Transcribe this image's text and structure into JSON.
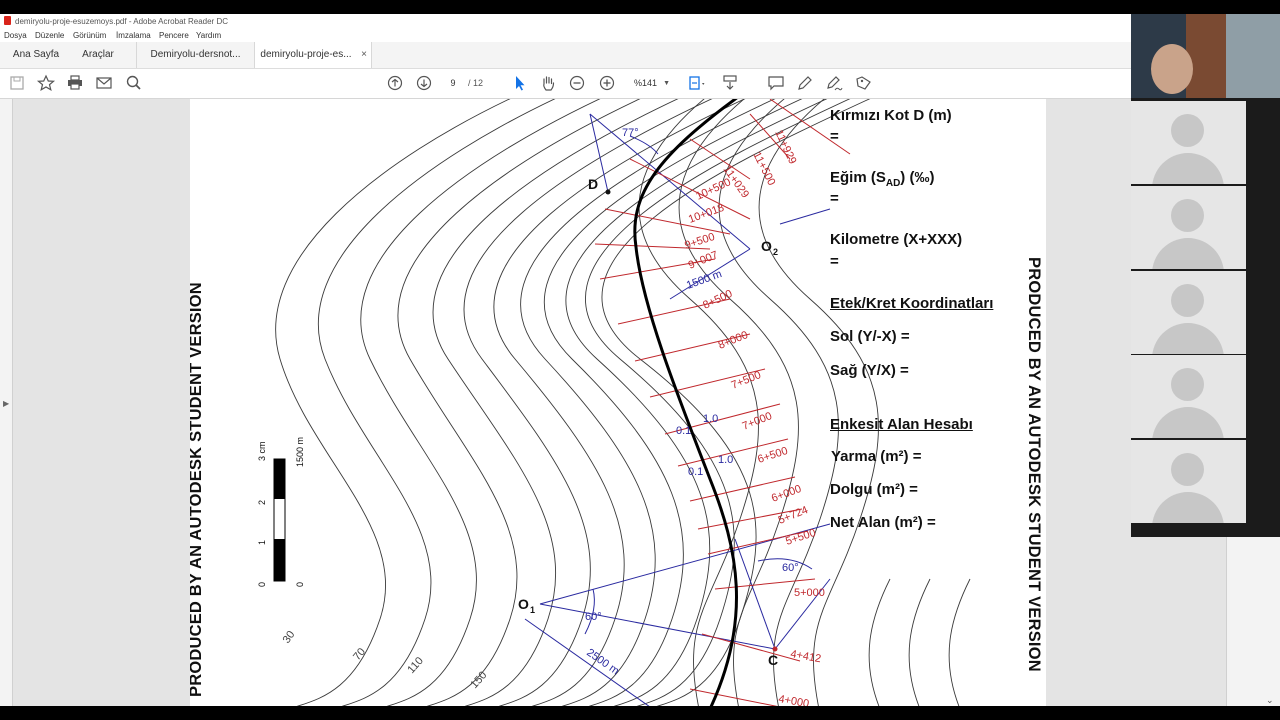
{
  "window": {
    "title": "demiryolu-proje-esuzemoys.pdf - Adobe Acrobat Reader DC"
  },
  "menu": {
    "items": [
      "Dosya",
      "Düzenle",
      "Görünüm",
      "İmzalama",
      "Pencere",
      "Yardım"
    ]
  },
  "tabs": {
    "home": "Ana Sayfa",
    "tools": "Araçlar",
    "doc1": "Demiryolu-dersnot...",
    "doc2": "demiryolu-proje-es...",
    "close": "×"
  },
  "toolbar": {
    "page_current": "9",
    "page_total": "/ 12",
    "zoom": "%141"
  },
  "colors": {
    "accent": "#1473e6",
    "contour": "#3a3a3a",
    "route": "#000000",
    "stations": "#c0282d",
    "geometry": "#2a2aa0"
  },
  "page": {
    "watermark": "PRODUCED BY AN AUTODESK STUDENT VERSION",
    "info": {
      "kirmizi": "Kırmızı Kot D (m)",
      "eq": "=",
      "egim_prefix": "Eğim (S",
      "egim_sub": "AD",
      "egim_suffix": ") (‰)",
      "kilometre": "Kilometre (X+XXX)",
      "etek": "Etek/Kret Koordinatları",
      "sol": "Sol (Y/-X) =",
      "sag": "Sağ (Y/X) =",
      "enkesit": "Enkesit Alan Hesabı",
      "yarma": "Yarma (m²)  =",
      "dolgu": "Dolgu (m²)   =",
      "net": "Net Alan (m²) ="
    },
    "map": {
      "stations": [
        {
          "label": "11+929"
        },
        {
          "label": "11+500"
        },
        {
          "label": "11+029"
        },
        {
          "label": "10+500"
        },
        {
          "label": "10+018"
        },
        {
          "label": "9+500"
        },
        {
          "label": "9+007"
        },
        {
          "label": "8+500"
        },
        {
          "label": "8+000"
        },
        {
          "label": "7+500"
        },
        {
          "label": "7+000"
        },
        {
          "label": "6+500"
        },
        {
          "label": "6+000"
        },
        {
          "label": "5+724"
        },
        {
          "label": "5+500"
        },
        {
          "label": "5+000"
        },
        {
          "label": "4+412"
        },
        {
          "label": "4+000"
        }
      ],
      "points": {
        "D": "D",
        "C": "C",
        "O1": "O",
        "O1_sub": "1",
        "O2": "O",
        "O2_sub": "2"
      },
      "angles": [
        "77°",
        "60°",
        "60°"
      ],
      "distances": [
        "1500 m",
        "2500 m"
      ],
      "slopes": [
        "0.1",
        "1.0",
        "0.1",
        "1.0"
      ],
      "contour_labels": [
        "30",
        "70",
        "110",
        "150"
      ],
      "scale": {
        "cm": "3 cm",
        "m": "1500 m",
        "ticks": [
          "2",
          "1",
          "0",
          "0"
        ]
      }
    }
  }
}
